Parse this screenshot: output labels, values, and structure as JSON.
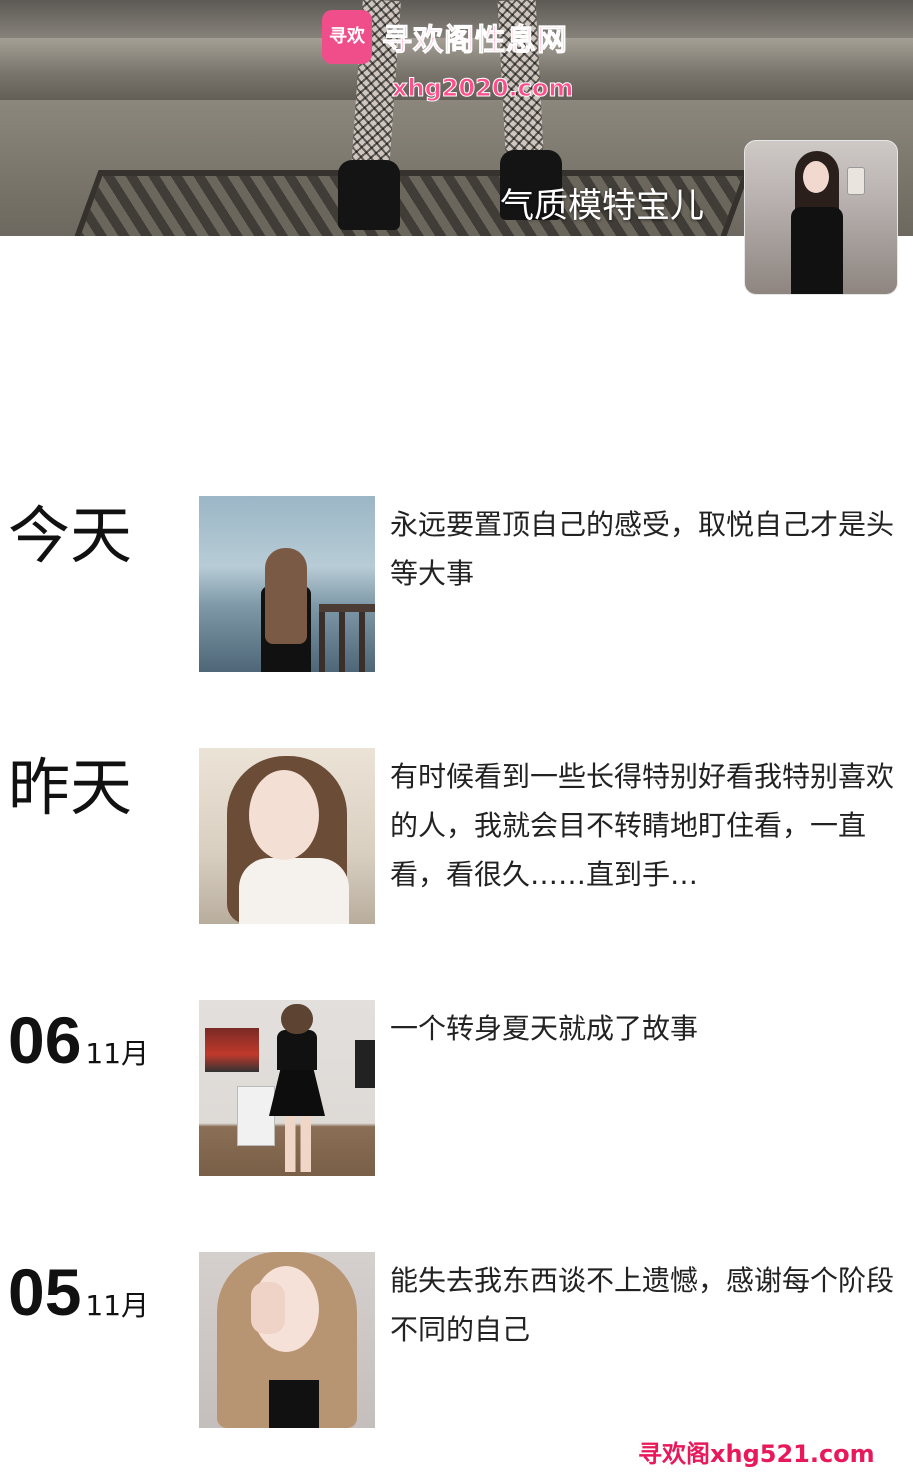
{
  "cover": {
    "watermark_logo": "寻欢",
    "watermark_title": "寻欢阁性息网",
    "watermark_url": "xhg2020.com",
    "nickname": "气质模特宝儿"
  },
  "timeline": [
    {
      "date_main": "今天",
      "date_month": "",
      "caption": "永远要置顶自己的感受，取悦自己才是头等大事",
      "thumb_icon": "photo-girl-by-sea"
    },
    {
      "date_main": "昨天",
      "date_month": "",
      "caption": "有时候看到一些长得特别好看我特别喜欢的人，我就会目不转睛地盯住看，一直看，看很久……直到手…",
      "thumb_icon": "photo-selfie-white-sweater"
    },
    {
      "date_main": "06",
      "date_month": "11月",
      "caption": "一个转身夏天就成了故事",
      "thumb_icon": "photo-mirror-selfie-black-dress"
    },
    {
      "date_main": "05",
      "date_month": "11月",
      "caption": "能失去我东西谈不上遗憾，感谢每个阶段不同的自己",
      "thumb_icon": "photo-portrait-hand-on-face"
    }
  ],
  "footer": {
    "watermark": "寻欢阁xhg521.com"
  }
}
